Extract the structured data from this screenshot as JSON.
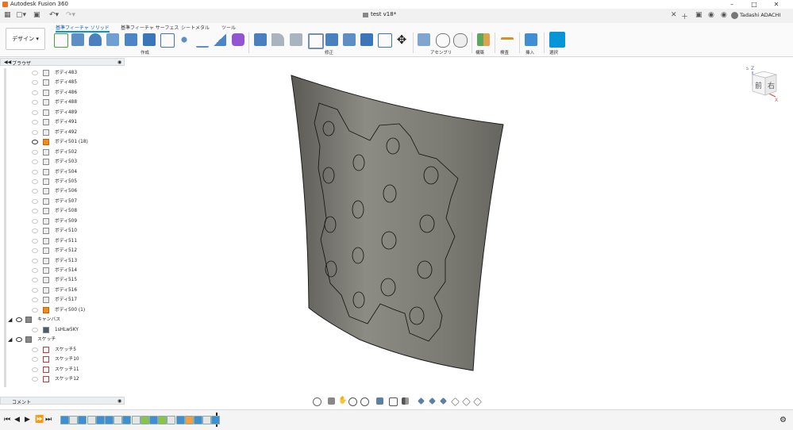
{
  "app": {
    "title": "Autodesk Fusion 360"
  },
  "window": {
    "minimize_icon": "minimize-icon",
    "maximize_icon": "maximize-icon",
    "close_icon": "close-icon"
  },
  "doc_tab": {
    "title": "test v18*"
  },
  "user": {
    "name": "Tadashi ADACHI"
  },
  "ribbon": {
    "workspace": "デザイン",
    "tabs": [
      {
        "label": "基準フィーチャ ソリッド",
        "active": true
      },
      {
        "label": "基準フィーチャ サーフェス",
        "active": false
      },
      {
        "label": "シートメタル",
        "active": false
      },
      {
        "label": "ツール",
        "active": false
      }
    ],
    "groups": [
      "作成",
      "修正",
      "アセンブリ",
      "構築",
      "検査",
      "挿入",
      "選択"
    ]
  },
  "browser": {
    "title": "ブラウザ",
    "items": [
      {
        "label": "ボディ483",
        "type": "body",
        "visible": false
      },
      {
        "label": "ボディ485",
        "type": "body",
        "visible": false
      },
      {
        "label": "ボディ486",
        "type": "body",
        "visible": false
      },
      {
        "label": "ボディ488",
        "type": "body",
        "visible": false
      },
      {
        "label": "ボディ489",
        "type": "body",
        "visible": false
      },
      {
        "label": "ボディ491",
        "type": "body",
        "visible": false
      },
      {
        "label": "ボディ492",
        "type": "body",
        "visible": false
      },
      {
        "label": "ボディ501 (18)",
        "type": "body-highlight",
        "visible": true
      },
      {
        "label": "ボディ502",
        "type": "body",
        "visible": false
      },
      {
        "label": "ボディ503",
        "type": "body",
        "visible": false
      },
      {
        "label": "ボディ504",
        "type": "body",
        "visible": false
      },
      {
        "label": "ボディ505",
        "type": "body",
        "visible": false
      },
      {
        "label": "ボディ506",
        "type": "body",
        "visible": false
      },
      {
        "label": "ボディ507",
        "type": "body",
        "visible": false
      },
      {
        "label": "ボディ508",
        "type": "body",
        "visible": false
      },
      {
        "label": "ボディ509",
        "type": "body",
        "visible": false
      },
      {
        "label": "ボディ510",
        "type": "body",
        "visible": false
      },
      {
        "label": "ボディ511",
        "type": "body",
        "visible": false
      },
      {
        "label": "ボディ512",
        "type": "body",
        "visible": false
      },
      {
        "label": "ボディ513",
        "type": "body",
        "visible": false
      },
      {
        "label": "ボディ514",
        "type": "body",
        "visible": false
      },
      {
        "label": "ボディ515",
        "type": "body",
        "visible": false
      },
      {
        "label": "ボディ516",
        "type": "body",
        "visible": false
      },
      {
        "label": "ボディ517",
        "type": "body",
        "visible": false
      },
      {
        "label": "ボディ500 (1)",
        "type": "body-highlight",
        "visible": false
      },
      {
        "label": "キャンバス",
        "type": "folder",
        "visible": true
      },
      {
        "label": "1sHLw5KY",
        "type": "canvas",
        "visible": false
      },
      {
        "label": "スケッチ",
        "type": "folder",
        "visible": true
      },
      {
        "label": "スケッチ5",
        "type": "sketch",
        "visible": false
      },
      {
        "label": "スケッチ10",
        "type": "sketch",
        "visible": false
      },
      {
        "label": "スケッチ11",
        "type": "sketch",
        "visible": false
      },
      {
        "label": "スケッチ12",
        "type": "sketch",
        "visible": false
      }
    ]
  },
  "comments": {
    "title": "コメント"
  },
  "viewcube": {
    "front": "前",
    "right": "右",
    "axis_z": "Z",
    "axis_x": "X"
  },
  "colors": {
    "accent": "#0696d7",
    "surface": "#7d7c74",
    "highlight_body": "#f38c1f"
  }
}
